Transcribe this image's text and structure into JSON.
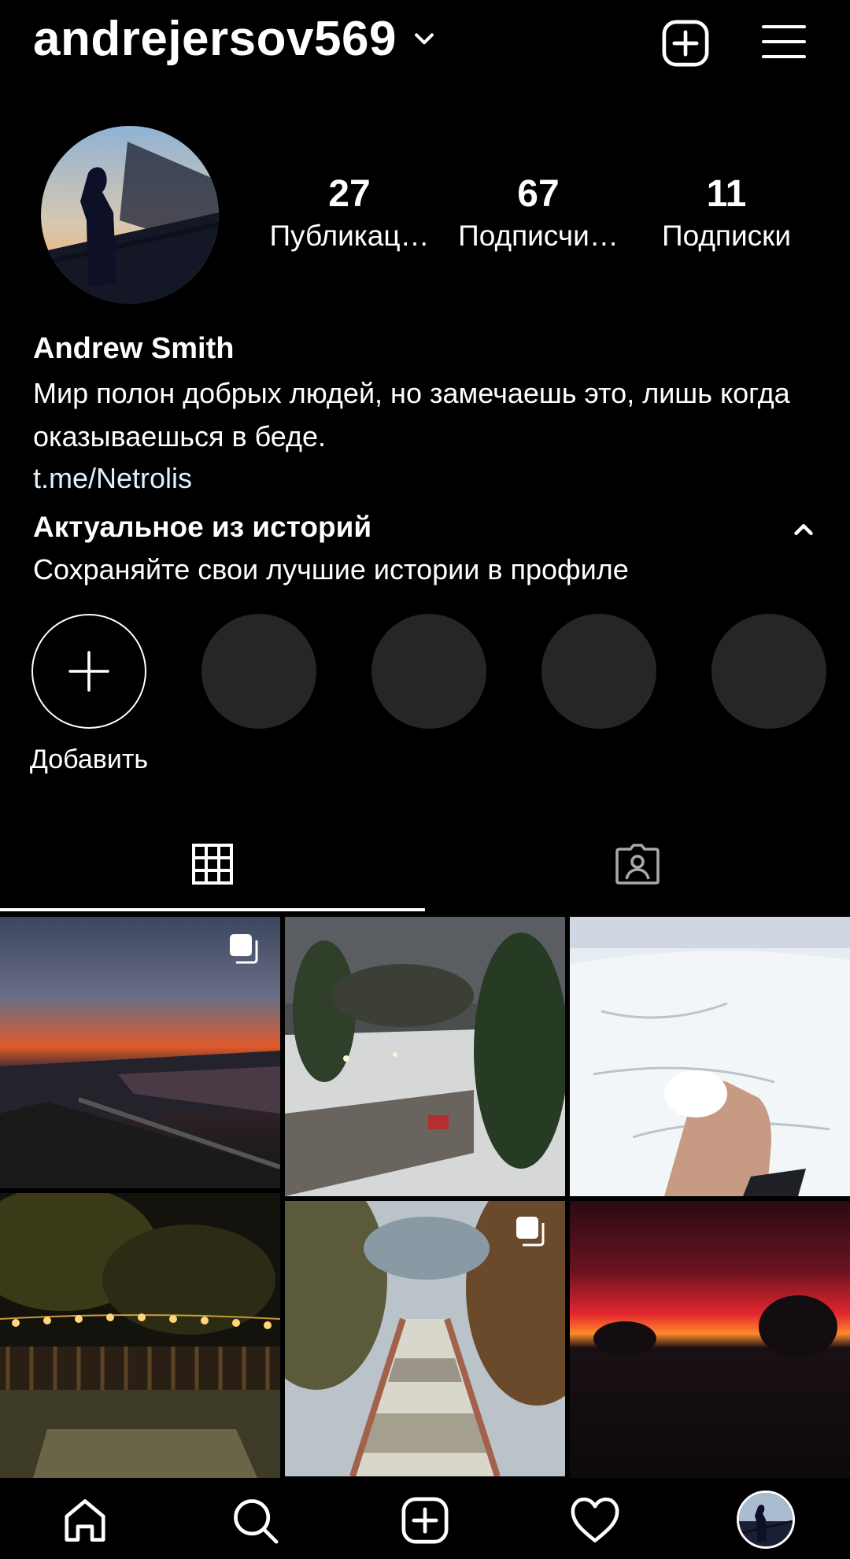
{
  "header": {
    "username": "andrejersov569"
  },
  "profile": {
    "stats": [
      {
        "value": "27",
        "label": "Публикац…"
      },
      {
        "value": "67",
        "label": "Подписчи…"
      },
      {
        "value": "11",
        "label": "Подписки"
      }
    ],
    "name": "Andrew Smith",
    "bio": "Мир полон добрых людей, но замечаешь это, лишь когда оказываешься в беде.",
    "link": "t.me/Netrolis"
  },
  "highlights": {
    "title": "Актуальное из историй",
    "subtitle": "Сохраняйте свои лучшие истории в профиле",
    "add_label": "Добавить"
  },
  "icons": {
    "chevron": "chevron-down-icon",
    "add_post": "plus-square-icon",
    "menu": "hamburger-menu-icon",
    "collapse": "chevron-up-icon",
    "grid_tab": "grid-icon",
    "tagged_tab": "tagged-person-icon",
    "multi_post": "multiple-photos-icon",
    "nav": [
      "home-icon",
      "search-icon",
      "plus-square-icon",
      "heart-icon",
      "profile-avatar"
    ]
  },
  "colors": {
    "background": "#000000",
    "text": "#ffffff",
    "link": "#e0f1ff",
    "placeholder": "#262626"
  },
  "grid": {
    "posts": [
      {
        "scene": "sunset over river",
        "multiple": true
      },
      {
        "scene": "snowy park with trees",
        "multiple": false
      },
      {
        "scene": "hand holding snow in field",
        "multiple": false
      },
      {
        "scene": "evening lights over fence",
        "multiple": false
      },
      {
        "scene": "autumn park alley",
        "multiple": true
      },
      {
        "scene": "red sky at night",
        "multiple": false
      }
    ]
  }
}
